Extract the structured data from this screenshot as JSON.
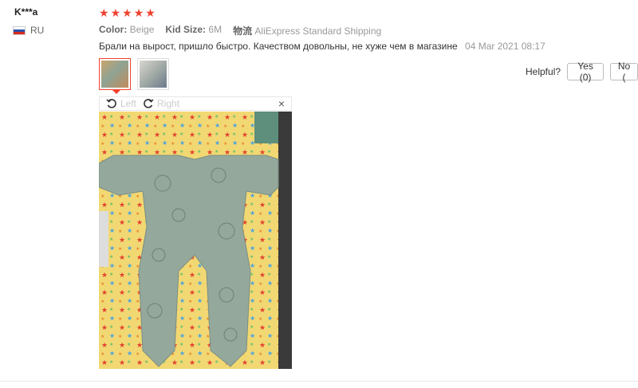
{
  "review": {
    "username": "K***a",
    "country": "RU",
    "rating": 5,
    "specs": [
      {
        "key": "Color:",
        "value": "Beige"
      },
      {
        "key": "Kid Size:",
        "value": "6M"
      },
      {
        "key": "物流",
        "value": "AliExpress Standard Shipping"
      }
    ],
    "text": "Брали на вырост, пришло быстро. Качеством довольны, не хуже чем в магазине",
    "time": "04 Mar 2021 08:17"
  },
  "helpful": {
    "label": "Helpful?",
    "yes_label": "Yes (0)",
    "no_label": "No ("
  },
  "viewer": {
    "left_label": "Left",
    "right_label": "Right",
    "close_label": "×"
  },
  "colors": {
    "accent": "#f0412f",
    "muted": "#999999"
  }
}
